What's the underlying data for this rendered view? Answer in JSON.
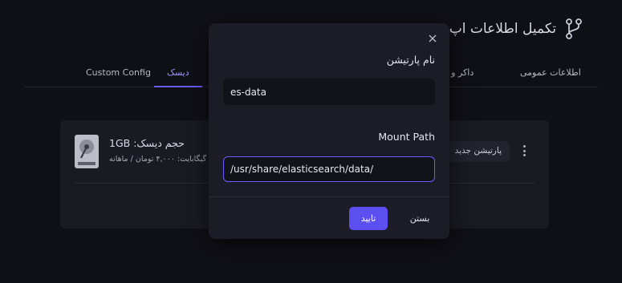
{
  "header": {
    "title": "تکمیل اطلاعات اپ",
    "icon": "git-branch-icon"
  },
  "tabs": [
    {
      "label": "اطلاعات عمومی",
      "active": false
    },
    {
      "label": "داکر و سرویس",
      "active": false
    },
    {
      "label": "دیسک",
      "active": true
    },
    {
      "label": "Custom Config",
      "active": false
    }
  ],
  "disk": {
    "size": "حجم دیسک: 1GB",
    "price": "هر گیگابایت: ۴,۰۰۰ تومان / ماهانه",
    "add_partition_label": "پارتیشن جدید",
    "icon": "hard-drive-icon"
  },
  "modal": {
    "close_icon": "close-icon",
    "name_label": "نام پارتیشن",
    "name_value": "es-data",
    "mount_label": "Mount Path",
    "mount_value": "/usr/share/elasticsearch/data/",
    "confirm_label": "تایید",
    "cancel_label": "بستن"
  },
  "colors": {
    "accent": "#5b4ff0",
    "background": "#0f0f16",
    "modal": "#1c1c26",
    "card": "#1a1a23"
  }
}
